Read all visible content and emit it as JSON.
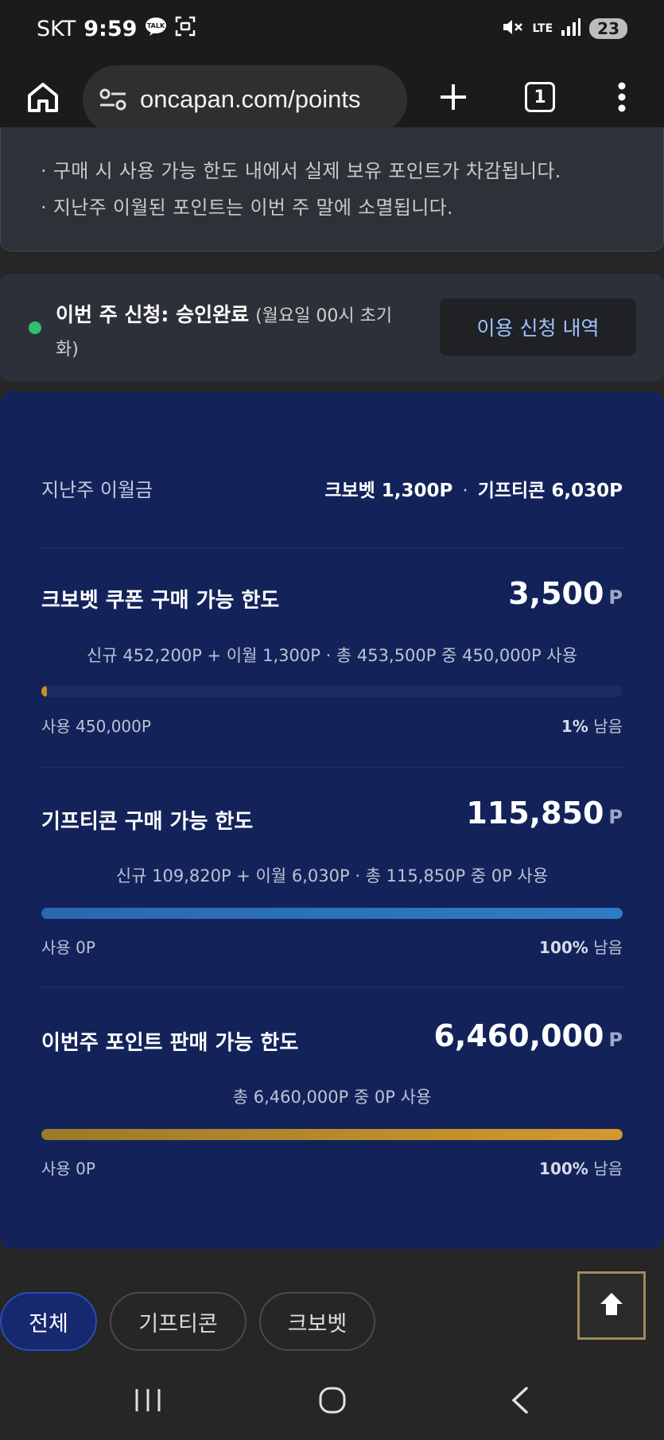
{
  "status_bar": {
    "carrier": "SKT",
    "time": "9:59",
    "kakao_label": "TALK",
    "network": "LTE",
    "battery": "23"
  },
  "browser": {
    "url": "oncapan.com/points",
    "tab_count": "1"
  },
  "notice": {
    "lines": [
      "· 구매 시 사용 가능 한도 내에서 실제 보유 포인트가 차감됩니다.",
      "· 지난주 이월된 포인트는 이번 주 말에 소멸됩니다."
    ]
  },
  "application": {
    "label": "이번 주 신청: 승인완료",
    "note": "(월요일 00시 초기화)",
    "status_color": "#2fbf71",
    "history_button": "이용 신청 내역"
  },
  "carryover": {
    "label": "지난주 이월금",
    "crobet": "크보벳 1,300P",
    "separator": "·",
    "gifticon": "기프티콘 6,030P"
  },
  "sections": [
    {
      "title": "크보벳 쿠폰 구매 가능 한도",
      "amount": "3,500",
      "unit": "P",
      "desc": "신규 452,200P + 이월 1,300P · 총 453,500P 중 450,000P 사용",
      "used": "사용 450,000P",
      "remain_pct": "1%",
      "remain_suffix": "남음",
      "fill_percent": 1,
      "bar_color": "#c9902a"
    },
    {
      "title": "기프티콘 구매 가능 한도",
      "amount": "115,850",
      "unit": "P",
      "desc": "신규 109,820P + 이월 6,030P · 총 115,850P 중 0P 사용",
      "used": "사용 0P",
      "remain_pct": "100%",
      "remain_suffix": "남음",
      "fill_percent": 100,
      "bar_color": "#2d6fb3"
    },
    {
      "title": "이번주 포인트 판매 가능 한도",
      "amount": "6,460,000",
      "unit": "P",
      "desc": "총 6,460,000P 중 0P 사용",
      "used": "사용 0P",
      "remain_pct": "100%",
      "remain_suffix": "남음",
      "fill_percent": 100,
      "bar_color": "#c9902a"
    }
  ],
  "filters": {
    "all": "전체",
    "gifticon": "기프티콘",
    "crobet": "크보벳"
  },
  "icons": {
    "home": "home-icon",
    "tune": "tune-icon",
    "plus": "plus-icon",
    "menu": "more-vert-icon",
    "scroll_top": "arrow-up-icon"
  }
}
